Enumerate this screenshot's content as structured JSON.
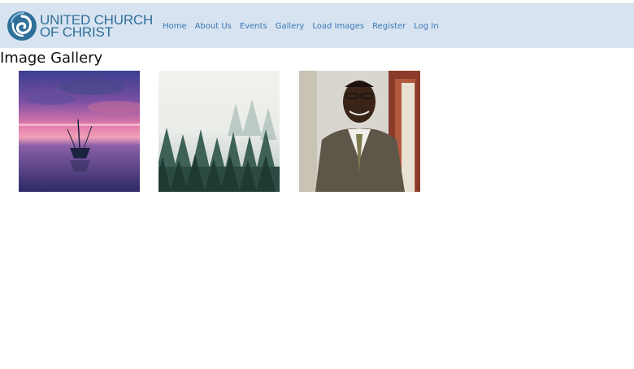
{
  "brand": {
    "line1": "UNITED CHURCH",
    "line2": "OF CHRIST",
    "logo_icon": "ucc-swirl-logo"
  },
  "nav": {
    "items": [
      {
        "label": "Home"
      },
      {
        "label": "About Us"
      },
      {
        "label": "Events"
      },
      {
        "label": "Gallery"
      },
      {
        "label": "Load Images"
      },
      {
        "label": "Register"
      },
      {
        "label": "Log In"
      }
    ]
  },
  "page": {
    "title": "Image Gallery"
  },
  "gallery": {
    "images": [
      {
        "subject": "boat on a lake at sunset"
      },
      {
        "subject": "misty pine forest"
      },
      {
        "subject": "portrait of a man in a suit"
      }
    ]
  },
  "colors": {
    "navbar_bg": "#d7e3f0",
    "brand_blue": "#2f6f99",
    "link_blue": "#3a78b8"
  }
}
